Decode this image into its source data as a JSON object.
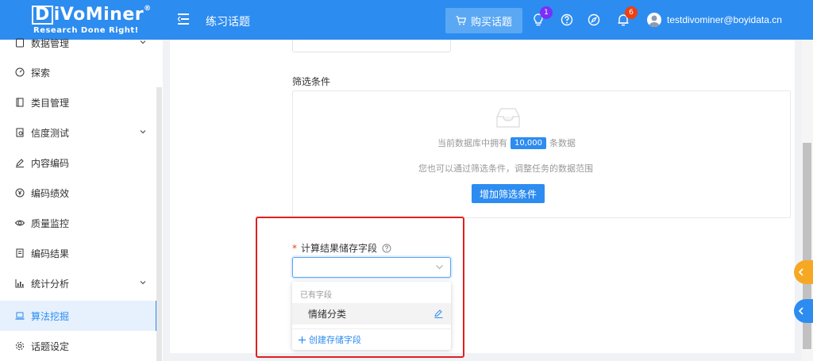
{
  "header": {
    "logo_main": "iVoMiner",
    "logo_d": "D",
    "logo_reg": "®",
    "logo_sub": "Research Done Right!",
    "page_title": "练习话题",
    "buy_label": "购买话题",
    "tips_badge": "1",
    "notify_badge": "6",
    "user_email": "testdivominer@boyidata.cn",
    "colors": {
      "bar": "#2d8cf0",
      "buy_button": "#5aa8f4",
      "tips_badge": "#7b2ff7",
      "notify_badge": "#ed4014"
    }
  },
  "sidebar": {
    "items": [
      {
        "label": "数据管理",
        "icon": "database-icon"
      },
      {
        "label": "探索",
        "icon": "gauge-icon"
      },
      {
        "label": "类目管理",
        "icon": "file-icon"
      },
      {
        "label": "信度测试",
        "icon": "test-icon"
      },
      {
        "label": "内容编码",
        "icon": "pencil-icon"
      },
      {
        "label": "编码绩效",
        "icon": "yen-icon"
      },
      {
        "label": "质量监控",
        "icon": "eye-icon"
      },
      {
        "label": "编码结果",
        "icon": "doc-icon"
      },
      {
        "label": "统计分析",
        "icon": "bar-chart-icon"
      },
      {
        "label": "算法挖掘",
        "icon": "laptop-icon"
      },
      {
        "label": "话题设定",
        "icon": "gear-icon"
      }
    ],
    "active": "算法挖掘"
  },
  "filter": {
    "label": "筛选条件",
    "db_prefix": "当前数据库中拥有",
    "db_count": "10,000",
    "db_suffix": "条数据",
    "hint": "您也可以通过筛选条件，调整任务的数据范围",
    "add_button": "增加筛选条件"
  },
  "store_field": {
    "required_mark": "*",
    "label": "计算结果储存字段",
    "select_value": "",
    "dropdown": {
      "group_label": "已有字段",
      "option": "情绪分类",
      "create_label": "创建存储字段"
    }
  },
  "accent": "#2d8cf0",
  "highlight_color": "#e02020"
}
